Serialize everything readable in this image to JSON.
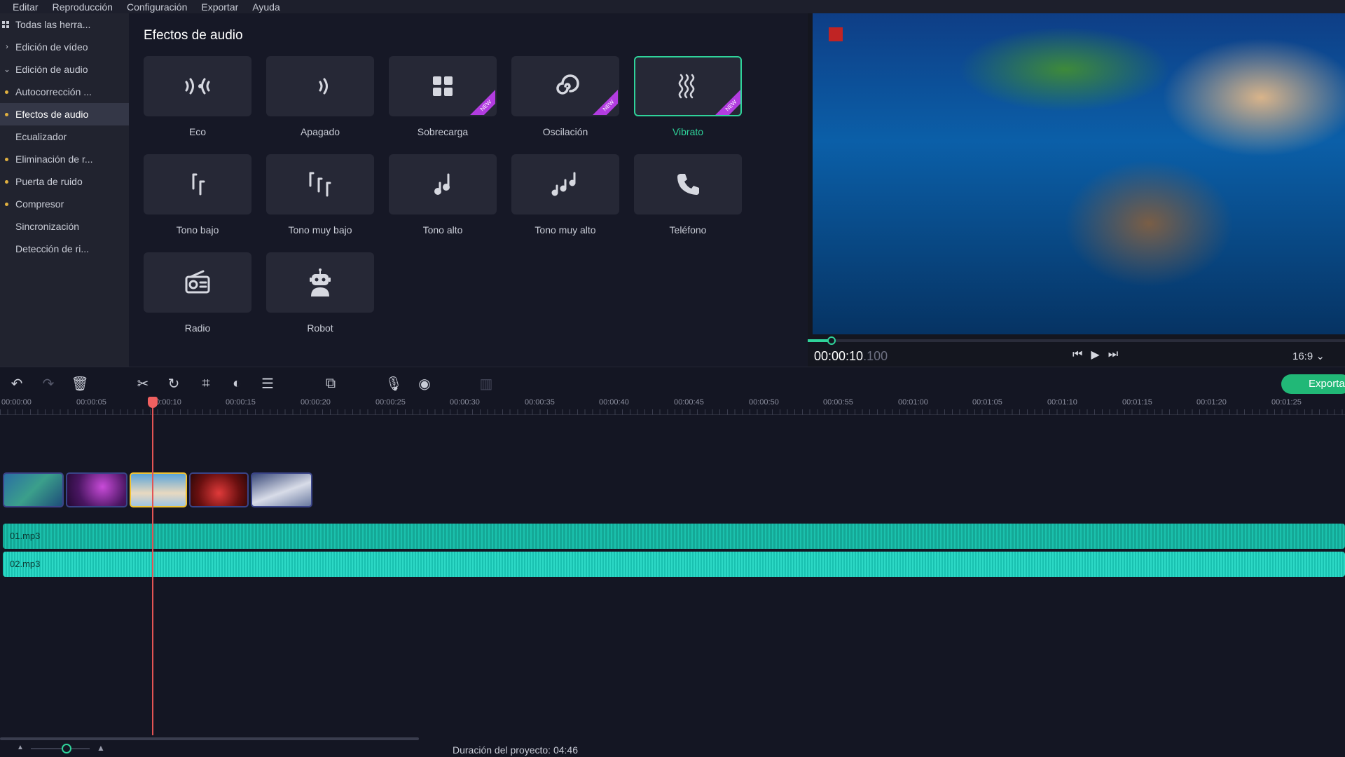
{
  "menu": [
    "Editar",
    "Reproducción",
    "Configuración",
    "Exportar",
    "Ayuda"
  ],
  "sidebar": {
    "items": [
      {
        "label": "Todas las herra...",
        "prefix": "grid"
      },
      {
        "label": "Edición de vídeo",
        "prefix": "›"
      },
      {
        "label": "Edición de audio",
        "prefix": "⌄"
      },
      {
        "label": "Autocorrección ...",
        "prefix": "dot"
      },
      {
        "label": "Efectos de audio",
        "prefix": "dot",
        "active": true
      },
      {
        "label": "Ecualizador",
        "prefix": ""
      },
      {
        "label": "Eliminación de r...",
        "prefix": "dot"
      },
      {
        "label": "Puerta de ruido",
        "prefix": "dot"
      },
      {
        "label": "Compresor",
        "prefix": "dot"
      },
      {
        "label": "Sincronización",
        "prefix": ""
      },
      {
        "label": "Detección de ri...",
        "prefix": ""
      }
    ]
  },
  "effects": {
    "title": "Efectos de audio",
    "badge": "NEW",
    "tiles": [
      {
        "label": "Eco",
        "icon": "echo-icon"
      },
      {
        "label": "Apagado",
        "icon": "muffled-icon"
      },
      {
        "label": "Sobrecarga",
        "icon": "overdrive-icon",
        "new": true
      },
      {
        "label": "Oscilación",
        "icon": "spiral-icon",
        "new": true
      },
      {
        "label": "Vibrato",
        "icon": "vibrato-icon",
        "new": true,
        "selected": true
      },
      {
        "label": "Tono bajo",
        "icon": "low-pitch-icon"
      },
      {
        "label": "Tono muy bajo",
        "icon": "very-low-pitch-icon"
      },
      {
        "label": "Tono alto",
        "icon": "high-pitch-icon"
      },
      {
        "label": "Tono muy alto",
        "icon": "very-high-pitch-icon"
      },
      {
        "label": "Teléfono",
        "icon": "phone-icon"
      },
      {
        "label": "Radio",
        "icon": "radio-icon"
      },
      {
        "label": "Robot",
        "icon": "robot-icon"
      }
    ]
  },
  "preview": {
    "timecode": "00:00:10",
    "timecode_ms": ".100",
    "aspect": "16:9 ⌄",
    "progress": 0.045
  },
  "toolbar": {
    "export_label": "Exportar",
    "icons": [
      "undo-icon",
      "redo-icon",
      "delete-icon",
      "cut-icon",
      "rotate-icon",
      "crop-icon",
      "color-icon",
      "adjust-icon",
      "overlay-icon",
      "mic-icon",
      "webcam-icon",
      "grid-icon"
    ]
  },
  "ruler": {
    "labels": [
      "00:00:00",
      "00:00:05",
      "00:00:10",
      "00:00:15",
      "00:00:20",
      "00:00:25",
      "00:00:30",
      "00:00:35",
      "00:00:40",
      "00:00:45",
      "00:00:50",
      "00:00:55",
      "00:01:00",
      "00:01:05",
      "00:01:10",
      "00:01:15",
      "00:01:20",
      "00:01:25"
    ]
  },
  "tracks": {
    "audio": [
      {
        "name": "01.mp3",
        "color": "#14a896"
      },
      {
        "name": "02.mp3",
        "color": "#19c1b0"
      }
    ],
    "clips": 5,
    "selected_clip": 3
  },
  "footer": {
    "duration": "Duración del proyecto: 04:46"
  },
  "colors": {
    "accent": "#2fd39a",
    "badge": "#b23ce0",
    "playhead": "#e35454"
  }
}
